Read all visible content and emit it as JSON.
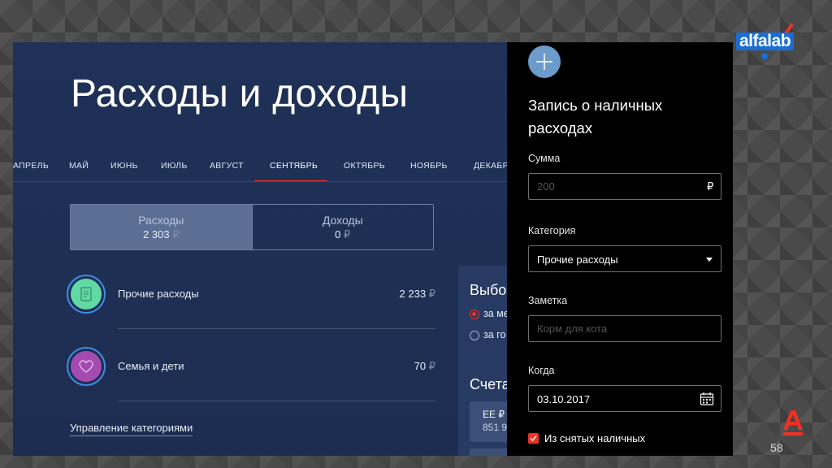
{
  "colors": {
    "accent_red": "#ef3124",
    "app_bg": "#1f3158",
    "drawer_bg": "#000000",
    "brand_blue": "#1b6dd4"
  },
  "branding": {
    "logo_text": "alfalab",
    "slide_number": "58"
  },
  "page": {
    "title": "Расходы и доходы"
  },
  "months": [
    {
      "label": "АПРЕЛЬ",
      "active": false
    },
    {
      "label": "МАЙ",
      "active": false
    },
    {
      "label": "ИЮНЬ",
      "active": false
    },
    {
      "label": "ИЮЛЬ",
      "active": false
    },
    {
      "label": "АВГУСТ",
      "active": false
    },
    {
      "label": "СЕНТЯБРЬ",
      "active": true
    },
    {
      "label": "ОКТЯБРЬ",
      "active": false
    },
    {
      "label": "НОЯБРЬ",
      "active": false
    },
    {
      "label": "ДЕКАБРЬ",
      "active": false
    }
  ],
  "toggle": {
    "expenses": {
      "label": "Расходы",
      "amount": "2 303",
      "currency": "₽"
    },
    "income": {
      "label": "Доходы",
      "amount": "0",
      "currency": "₽"
    }
  },
  "categories": [
    {
      "name": "Прочие расходы",
      "amount": "2 233",
      "currency": "₽",
      "icon": "document-icon",
      "color": "#62d9a4"
    },
    {
      "name": "Семья и дети",
      "amount": "70",
      "currency": "₽",
      "icon": "heart-icon",
      "color": "#a34bb0"
    }
  ],
  "manage_categories": "Управление категориями",
  "filter": {
    "title": "Выбо",
    "options": [
      {
        "label": "за ме",
        "checked": true
      },
      {
        "label": "за го",
        "checked": false
      }
    ],
    "accounts_title": "Счета",
    "account": {
      "name": "ЕЕ ₽",
      "amount": "851 9"
    }
  },
  "drawer": {
    "title": "Запись о наличных расходах",
    "amount_label": "Сумма",
    "amount_placeholder": "200",
    "amount_currency": "₽",
    "category_label": "Категория",
    "category_value": "Прочие расходы",
    "note_label": "Заметка",
    "note_placeholder": "Корм для кота",
    "date_label": "Когда",
    "date_value": "03.10.2017",
    "checkbox_label": "Из снятых наличных",
    "checkbox_checked": true
  }
}
